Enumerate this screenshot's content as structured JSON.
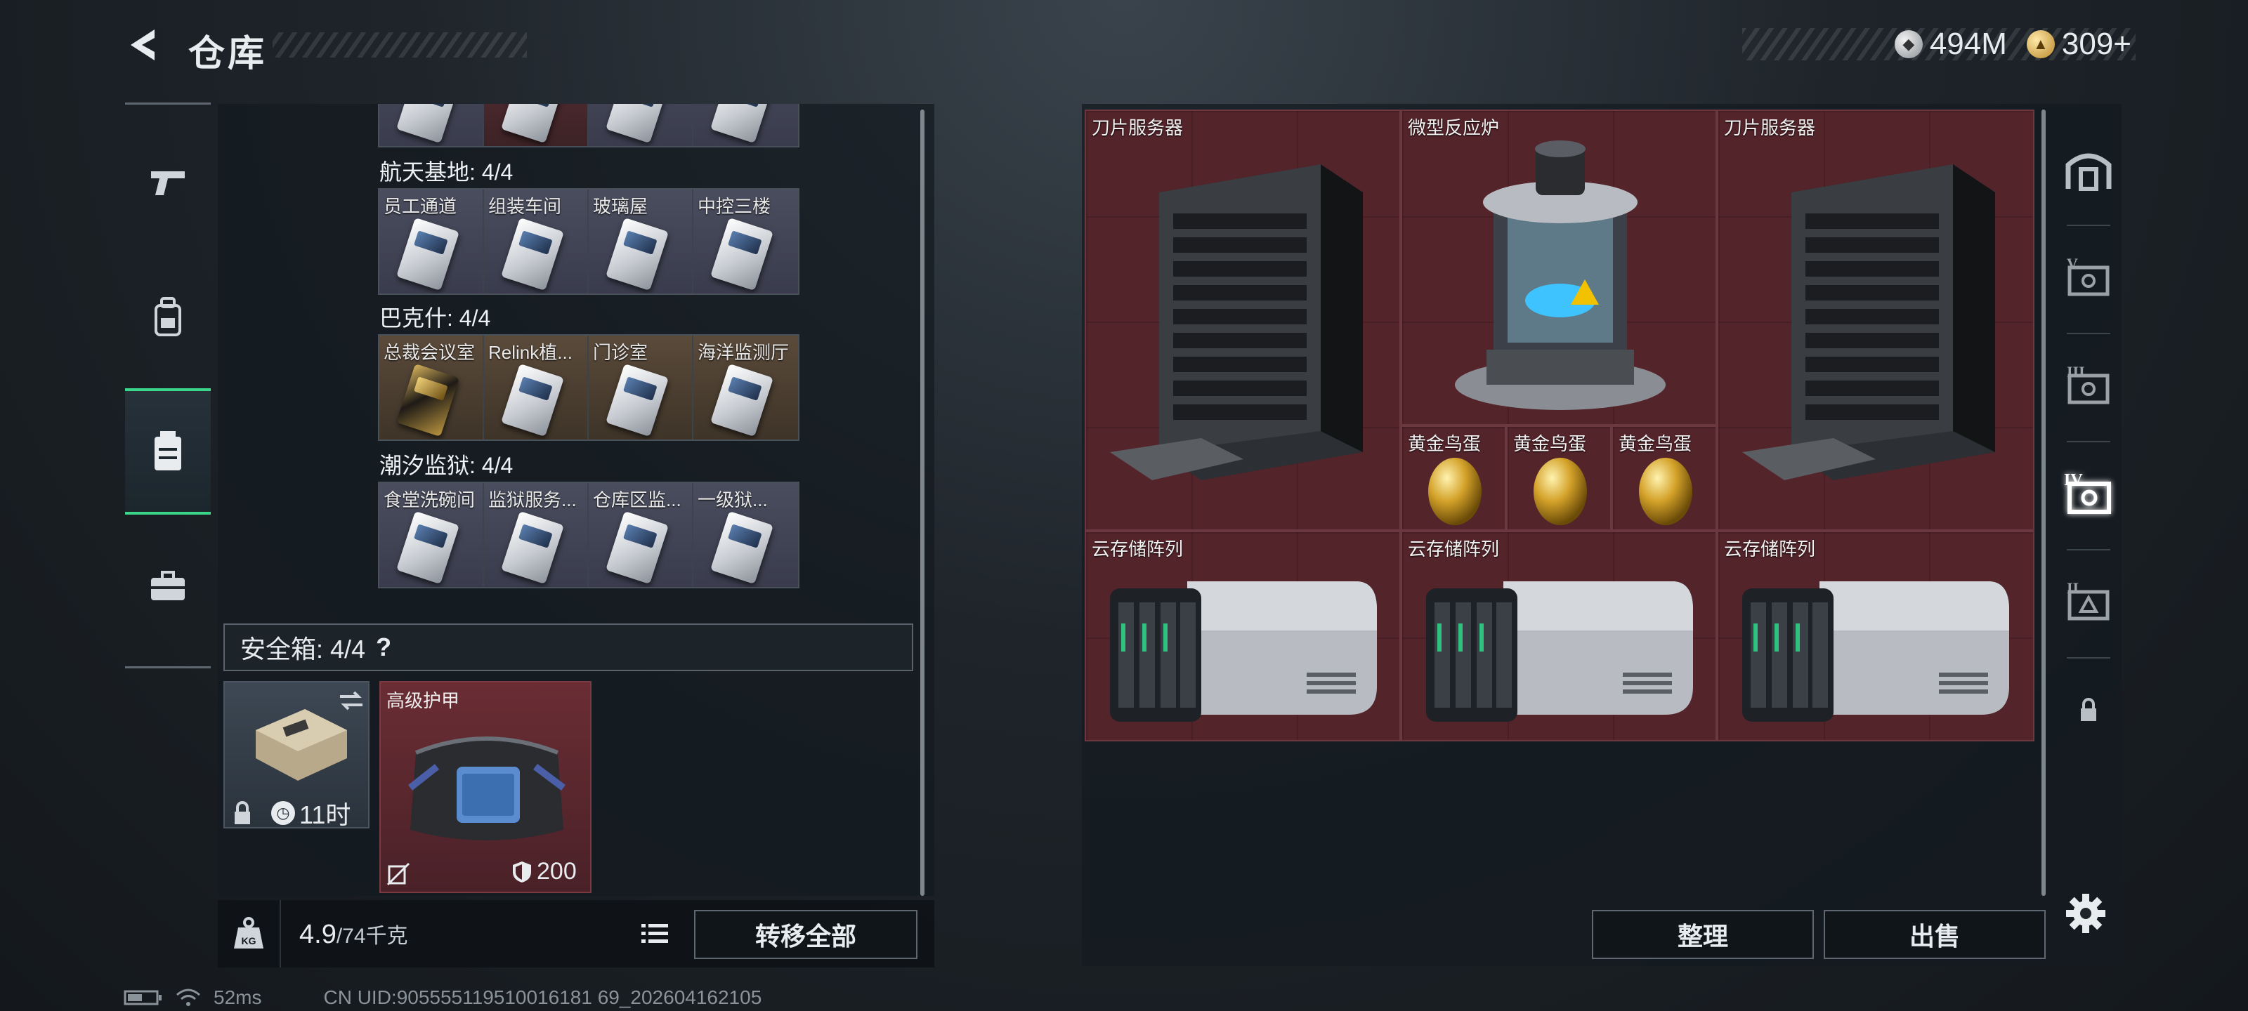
{
  "header": {
    "title": "仓库",
    "currency": [
      {
        "icon": "silver-coin-icon",
        "value": "494M"
      },
      {
        "icon": "gold-coin-icon",
        "value": "309+"
      }
    ]
  },
  "left_nav": [
    {
      "icon": "pistol-icon",
      "active": false
    },
    {
      "icon": "backpack-icon",
      "active": false
    },
    {
      "icon": "chest-rig-icon",
      "active": true
    },
    {
      "icon": "briefcase-icon",
      "active": false
    }
  ],
  "keycards": [
    {
      "label": "航天基地: 4/4",
      "cards": [
        {
          "name": "员工通道",
          "style": "blue"
        },
        {
          "name": "组装车间",
          "style": "blue"
        },
        {
          "name": "玻璃屋",
          "style": "blue"
        },
        {
          "name": "中控三楼",
          "style": "blue"
        }
      ]
    },
    {
      "label": "巴克什: 4/4",
      "cards": [
        {
          "name": "总裁会议室",
          "style": "gold"
        },
        {
          "name": "Relink植...",
          "style": "gold"
        },
        {
          "name": "门诊室",
          "style": "gold"
        },
        {
          "name": "海洋监测厅",
          "style": "gold"
        }
      ]
    },
    {
      "label": "潮汐监狱: 4/4",
      "cards": [
        {
          "name": "食堂洗碗间",
          "style": "blue"
        },
        {
          "name": "监狱服务...",
          "style": "blue"
        },
        {
          "name": "仓库区监...",
          "style": "blue"
        },
        {
          "name": "一级狱...",
          "style": "blue"
        }
      ]
    }
  ],
  "safe_box": {
    "label": "安全箱: 4/4",
    "help": "?",
    "timer": "11时",
    "armor_name": "高级护甲",
    "armor_durability": "200"
  },
  "weight": {
    "current": "4.9",
    "max": "/74千克",
    "transfer_all_label": "转移全部"
  },
  "stash": {
    "items": [
      {
        "name": "刀片服务器",
        "icon": "blade-server-icon"
      },
      {
        "name": "微型反应炉",
        "icon": "micro-reactor-icon"
      },
      {
        "name": "刀片服务器",
        "icon": "blade-server-icon"
      },
      {
        "name": "黄金鸟蛋",
        "icon": "golden-egg-icon"
      },
      {
        "name": "黄金鸟蛋",
        "icon": "golden-egg-icon"
      },
      {
        "name": "黄金鸟蛋",
        "icon": "golden-egg-icon"
      },
      {
        "name": "云存储阵列",
        "icon": "cloud-storage-icon"
      },
      {
        "name": "云存储阵列",
        "icon": "cloud-storage-icon"
      },
      {
        "name": "云存储阵列",
        "icon": "cloud-storage-icon"
      }
    ],
    "sort_label": "整理",
    "sell_label": "出售"
  },
  "right_tabs": [
    {
      "icon": "home-stash-icon",
      "active": false
    },
    {
      "icon": "stash-tab-v-icon",
      "active": false
    },
    {
      "icon": "stash-tab-iii-icon",
      "active": false
    },
    {
      "icon": "stash-tab-iv-icon",
      "active": true
    },
    {
      "icon": "stash-tab-ii-icon",
      "active": false
    },
    {
      "icon": "lock-icon",
      "active": false
    }
  ],
  "status": {
    "ping": "52ms",
    "uid": "CN UID:905555119510016181 69_202604162105"
  }
}
